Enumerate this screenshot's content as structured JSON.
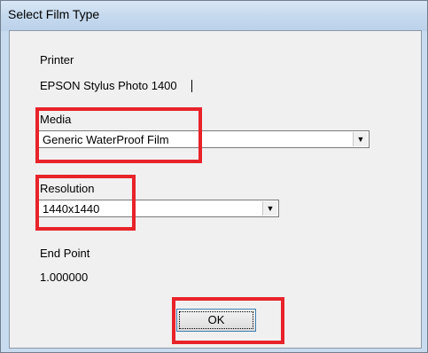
{
  "window": {
    "title": "Select Film Type"
  },
  "printer": {
    "label": "Printer",
    "value": "EPSON Stylus Photo 1400"
  },
  "media": {
    "label": "Media",
    "selected": "Generic WaterProof Film"
  },
  "resolution": {
    "label": "Resolution",
    "selected": "1440x1440"
  },
  "end_point": {
    "label": "End Point",
    "value": "1.000000"
  },
  "buttons": {
    "ok_label": "OK"
  },
  "colors": {
    "highlight": "#e8232a",
    "title_bar": "#c5d9ee",
    "client_bg": "#f0f0f0"
  },
  "icons": {
    "dropdown": "chevron-down-icon"
  }
}
